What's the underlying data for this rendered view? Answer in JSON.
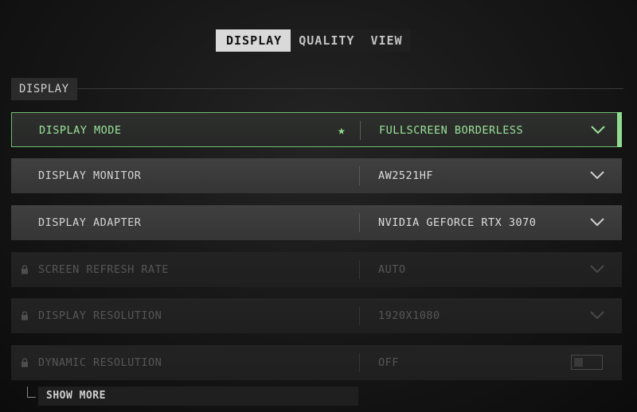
{
  "tabs": [
    {
      "label": "DISPLAY",
      "active": true
    },
    {
      "label": "QUALITY",
      "active": false
    },
    {
      "label": "VIEW",
      "active": false
    }
  ],
  "section": {
    "title": "DISPLAY"
  },
  "settings": [
    {
      "label": "DISPLAY MODE",
      "value": "FULLSCREEN BORDERLESS",
      "selected": true,
      "favorite_icon": "star-icon"
    },
    {
      "label": "DISPLAY MONITOR",
      "value": "AW2521HF"
    },
    {
      "label": "DISPLAY ADAPTER",
      "value": "NVIDIA GEFORCE RTX 3070"
    },
    {
      "label": "SCREEN REFRESH RATE",
      "value": "AUTO",
      "locked": true
    },
    {
      "label": "DISPLAY RESOLUTION",
      "value": "1920X1080",
      "locked": true
    },
    {
      "label": "DYNAMIC RESOLUTION",
      "value": "OFF",
      "locked": true,
      "control": "toggle"
    }
  ],
  "show_more": {
    "label": "SHOW MORE"
  },
  "colors": {
    "accent_green": "#8fdc8f",
    "text": "#d3d3d3",
    "locked_text": "#565656"
  }
}
